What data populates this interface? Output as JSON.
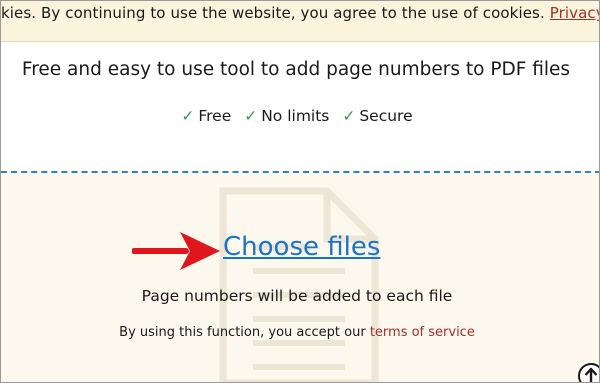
{
  "cookie_bar": {
    "text": "kies. By continuing to use the website, you agree to the use of cookies.",
    "link_label": "Privacy P"
  },
  "hero": {
    "subtitle": "Free and easy to use tool to add page numbers to PDF files",
    "features": [
      {
        "icon": "check-icon",
        "check": "✓",
        "label": "Free"
      },
      {
        "icon": "check-icon",
        "check": "✓",
        "label": "No limits"
      },
      {
        "icon": "check-icon",
        "check": "✓",
        "label": "Secure"
      }
    ]
  },
  "upload": {
    "choose_files_label": "Choose files",
    "info": "Page numbers will be added to each file",
    "tos_prefix": "By using this function, you accept our",
    "tos_link": "terms of service"
  },
  "icons": {
    "arrow": "arrow-right-icon",
    "document": "document-icon",
    "scroll_top": "arrow-up-circle-icon"
  },
  "colors": {
    "cookie_background": "#fbf4dc",
    "link_red": "#a0312b",
    "check_green": "#3a9a5b",
    "choose_files_blue": "#1a73c9",
    "dropzone_border": "#2f7fc6",
    "dropzone_background": "#fcf8ee",
    "arrow_red": "#e0161e"
  }
}
